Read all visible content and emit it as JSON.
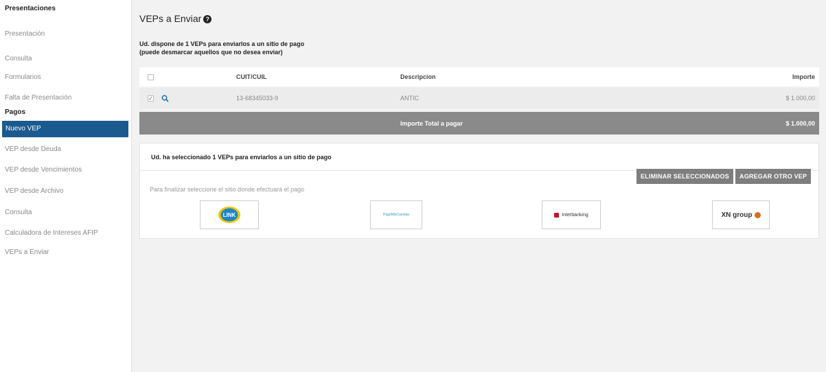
{
  "sidebar": {
    "presentaciones_title": "Presentaciones",
    "presentaciones_items": [
      "Presentación",
      "Consulta",
      "Formularios",
      "Falta de Presentación"
    ],
    "pagos_title": "Pagos",
    "active_item": "Nuevo VEP",
    "pagos_items": [
      "VEP desde Deuda",
      "VEP desde Vencimientos",
      "VEP desde Archivo",
      "Consulta",
      "Calculadora de Intereses AFIP",
      "VEPs a Enviar"
    ]
  },
  "main": {
    "title": "VEPs a Enviar",
    "intro_line1": "Ud. dispone de 1 VEPs para enviarlos a un sitio de pago",
    "intro_line2": "(puede desmarcar aquellos que no desea enviar)",
    "table": {
      "headers": {
        "cuit": "CUIT/CUIL",
        "descripcion": "Descripcion",
        "importe": "Importe"
      },
      "row": {
        "checked": true,
        "cuit": "13-68345033-9",
        "descripcion": "ANTIC",
        "importe": "$ 1.000,00"
      },
      "total_label": "Importe Total a pagar",
      "total_value": "$ 1.000,00"
    },
    "panel": {
      "message": "Ud. ha seleccionado 1 VEPs para enviarlos a un sitio de pago",
      "btn_eliminar": "ELIMINAR SELECCIONADOS",
      "btn_agregar": "AGREGAR OTRO VEP",
      "finalize": "Para finalizar seleccione el sitio donde efectuará el pago",
      "sites": {
        "link": "LINK",
        "pagomiscuentas": "PagoMisCuentas",
        "interbanking": "Interbanking",
        "xn_group": "XN group"
      }
    }
  },
  "colors": {
    "active": "#1a5a8e",
    "total_bar": "#8a8a8a",
    "link_icon": "#1d86c8",
    "interbanking": "#c0182a",
    "xn_orange": "#e06a1a"
  }
}
